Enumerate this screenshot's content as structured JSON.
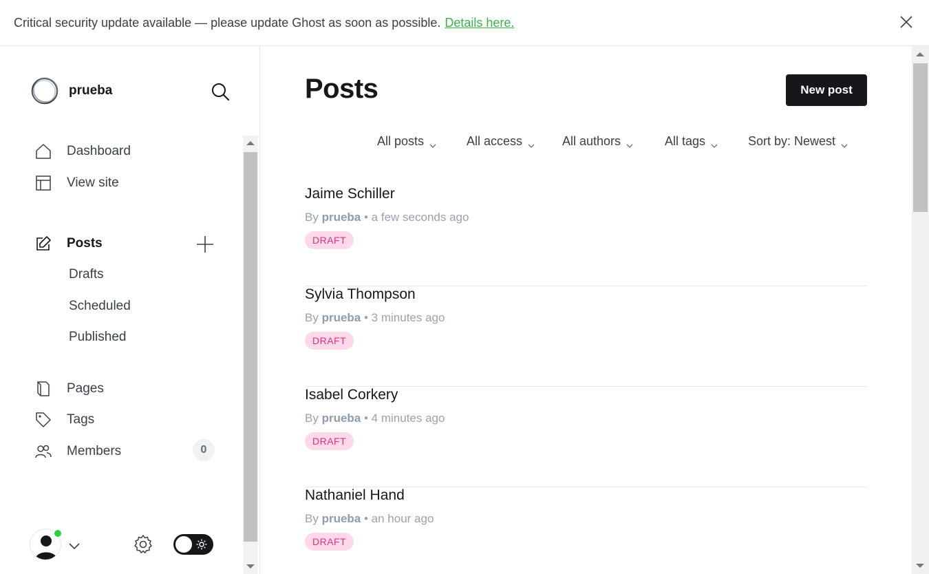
{
  "banner": {
    "message": "Critical security update available — please update Ghost as soon as possible.",
    "link_text": "Details here.",
    "close_icon": "close-icon"
  },
  "sidebar": {
    "site_name": "prueba",
    "nav": [
      {
        "label": "Dashboard",
        "icon": "home-icon"
      },
      {
        "label": "View site",
        "icon": "layout-icon"
      },
      {
        "label": "Posts",
        "icon": "edit-icon",
        "active": true
      },
      {
        "label": "Pages",
        "icon": "page-icon"
      },
      {
        "label": "Tags",
        "icon": "tag-icon"
      },
      {
        "label": "Members",
        "icon": "members-icon"
      }
    ],
    "post_subitems": [
      "Drafts",
      "Scheduled",
      "Published"
    ],
    "members_count": "0"
  },
  "main": {
    "title": "Posts",
    "new_post_label": "New post",
    "filters": [
      "All posts",
      "All access",
      "All authors",
      "All tags",
      "Sort by: Newest"
    ],
    "posts": [
      {
        "title": "Jaime Schiller",
        "by": "By",
        "author": "prueba",
        "time": "• a few seconds ago",
        "status": "DRAFT"
      },
      {
        "title": "Sylvia Thompson",
        "by": "By",
        "author": "prueba",
        "time": "• 3 minutes ago",
        "status": "DRAFT"
      },
      {
        "title": "Isabel Corkery",
        "by": "By",
        "author": "prueba",
        "time": "• 4 minutes ago",
        "status": "DRAFT"
      },
      {
        "title": "Nathaniel Hand",
        "by": "By",
        "author": "prueba",
        "time": "• an hour ago",
        "status": "DRAFT"
      }
    ]
  },
  "colors": {
    "accent_green": "#30cf43",
    "primary_dark": "#15171a",
    "draft_pink": "#e3307e"
  }
}
